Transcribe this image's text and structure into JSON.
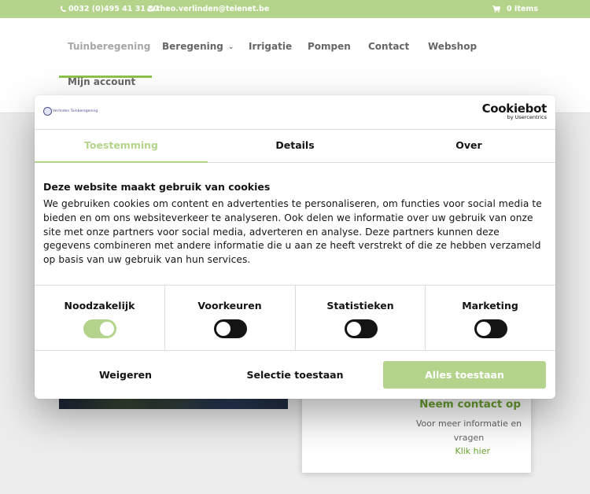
{
  "topbar": {
    "phone": "0032 (0)495 41 31 20",
    "email": "theo.verlinden@telenet.be",
    "cart": "0 Items",
    "phone_icon": "phone-icon",
    "email_icon": "envelope-icon",
    "cart_icon": "cart-icon"
  },
  "nav": {
    "tuinberegening": "Tuinberegening",
    "beregening": "Beregening",
    "irrigatie": "Irrigatie",
    "pompen": "Pompen",
    "contact": "Contact",
    "webshop": "Webshop",
    "mijn_account": "Mijn account"
  },
  "contact_card": {
    "title": "Neem contact op",
    "text": "Voor meer informatie en vragen",
    "link": "Klik hier"
  },
  "cookie": {
    "logo_small_text": "Verlinden Tuinberegening",
    "brand": "Cookiebot",
    "brand_sub": "by Usercentrics",
    "tabs": {
      "consent": "Toestemming",
      "details": "Details",
      "about": "Over"
    },
    "title": "Deze website maakt gebruik van cookies",
    "description": "We gebruiken cookies om content en advertenties te personaliseren, om functies voor social media te bieden en om ons websiteverkeer te analyseren. Ook delen we informatie over uw gebruik van onze site met onze partners voor social media, adverteren en analyse. Deze partners kunnen deze gegevens combineren met andere informatie die u aan ze heeft verstrekt of die ze hebben verzameld op basis van uw gebruik van hun services.",
    "toggles": {
      "necessary": "Noodzakelijk",
      "preferences": "Voorkeuren",
      "statistics": "Statistieken",
      "marketing": "Marketing"
    },
    "buttons": {
      "deny": "Weigeren",
      "allow_selection": "Selectie toestaan",
      "allow_all": "Alles toestaan"
    }
  },
  "colors": {
    "accent": "#b4d48c",
    "nav_underline": "#8cc34b",
    "contact_green": "#6ba42f"
  }
}
